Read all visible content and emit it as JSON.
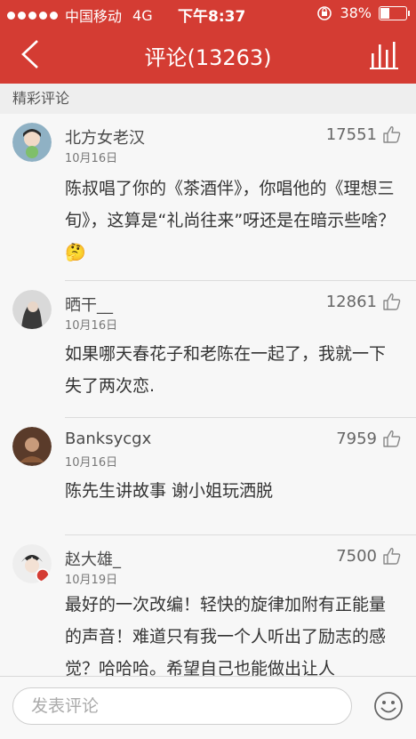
{
  "status_bar": {
    "carrier": "中国移动",
    "network": "4G",
    "time": "下午8:37",
    "battery": "38%",
    "battery_level": 0.38
  },
  "header": {
    "title": "评论(13263)"
  },
  "section": {
    "label": "精彩评论"
  },
  "comments": [
    {
      "name": "北方女老汉",
      "date": "10月16日",
      "likes": "17551",
      "text": "陈叔唱了你的《茶酒伴》，你唱他的《理想三旬》，这算是“礼尚往来”呀还是在暗示些啥？🤔"
    },
    {
      "name": "晒干__",
      "date": "10月16日",
      "likes": "12861",
      "text": "如果哪天春花子和老陈在一起了，我就一下失了两次恋."
    },
    {
      "name": "Banksycgx",
      "date": "10月16日",
      "likes": "7959",
      "text": "陈先生讲故事 谢小姐玩洒脱"
    },
    {
      "name": "赵大雄_",
      "date": "10月19日",
      "likes": "7500",
      "text": "最好的一次改编！轻快的旋律加附有正能量的声音！难道只有我一个人听出了励志的感觉？哈哈哈。希望自己也能做出让人"
    }
  ],
  "input": {
    "placeholder": "发表评论"
  },
  "colors": {
    "brand": "#d43c33"
  },
  "icons": {
    "back": "back-icon",
    "chart": "bars-icon",
    "like": "thumbs-up-icon",
    "emoji": "smiley-icon"
  }
}
